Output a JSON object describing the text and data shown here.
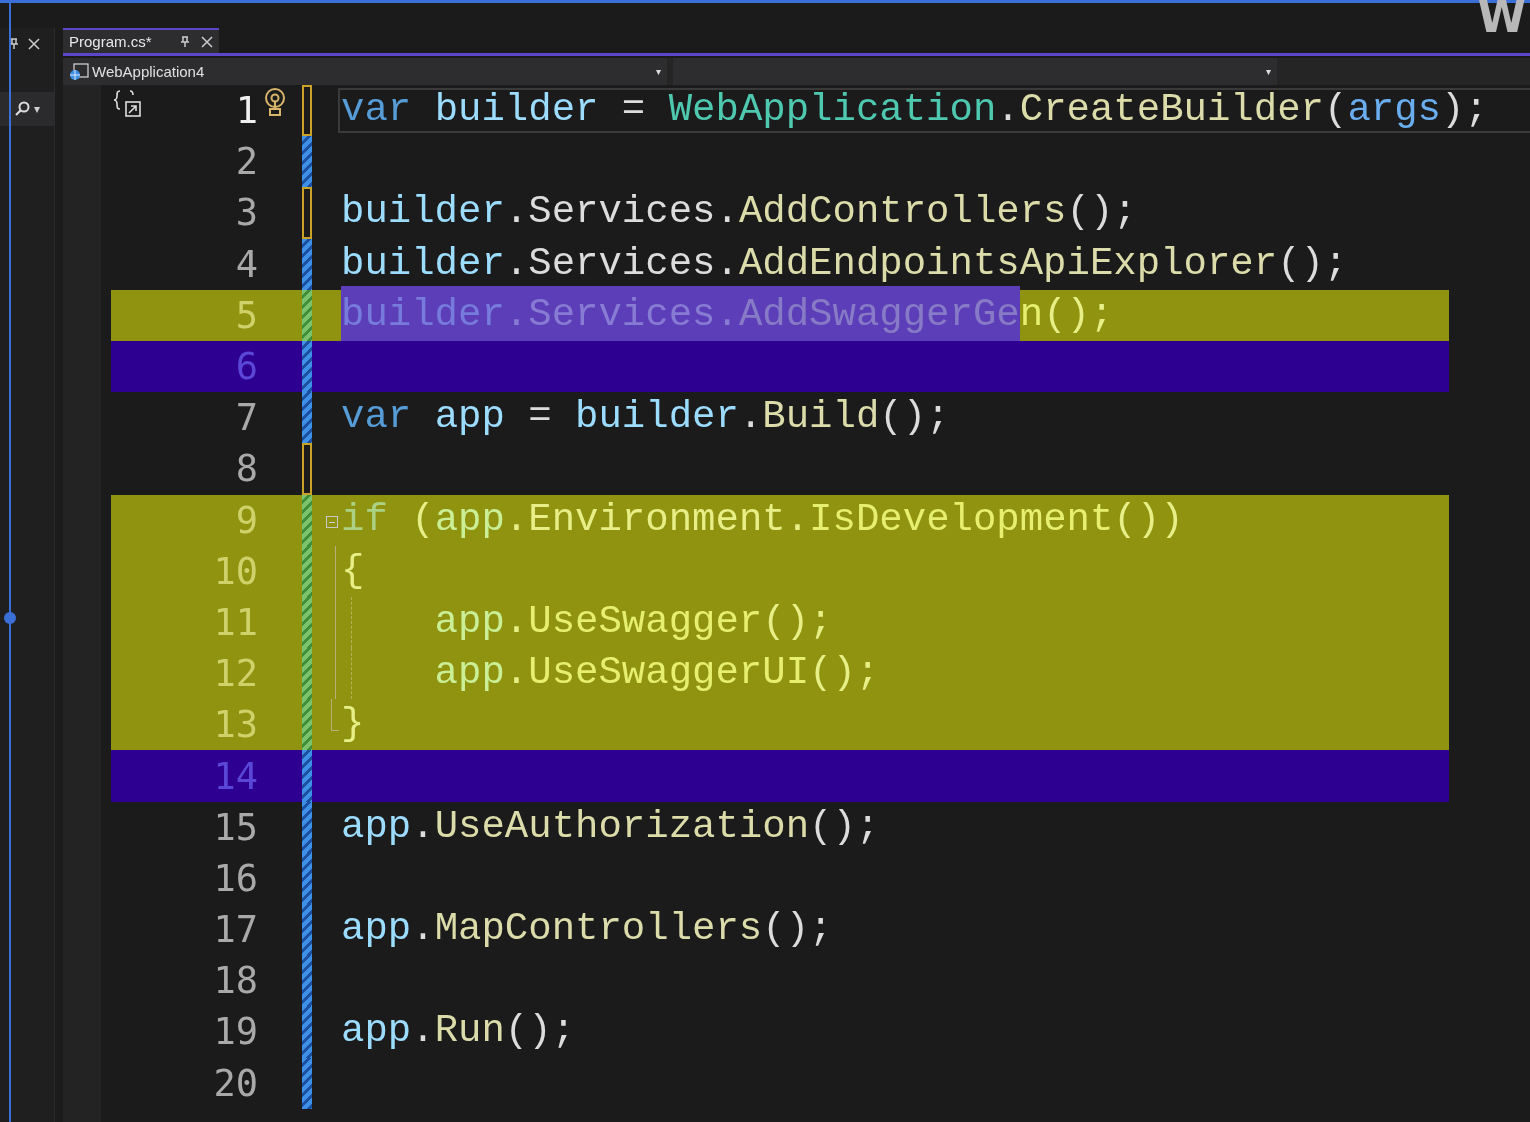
{
  "corner_text": "W",
  "tool_strip": {
    "search_caret": "▾"
  },
  "tabs": [
    {
      "label": "Program.cs*",
      "selected": true
    }
  ],
  "nav_bar": {
    "project": "WebApplication4",
    "caret": "▾",
    "member_caret": "▾"
  },
  "lines": [
    {
      "number": "1",
      "current": true,
      "lightbulb": true,
      "unsaved": true,
      "added": false,
      "removed": false,
      "tokens": [
        {
          "text": "var ",
          "kind": "keyword"
        },
        {
          "text": "builder",
          "kind": "local"
        },
        {
          "text": " = ",
          "kind": "plain"
        },
        {
          "text": "WebApplication",
          "kind": "type"
        },
        {
          "text": ".",
          "kind": "plain"
        },
        {
          "text": "CreateBuilder",
          "kind": "method"
        },
        {
          "text": "(",
          "kind": "plain"
        },
        {
          "text": "args",
          "kind": "param"
        },
        {
          "text": ");",
          "kind": "plain"
        }
      ]
    },
    {
      "number": "2",
      "current": false,
      "lightbulb": false,
      "unsaved": false,
      "added": false,
      "removed": false
    },
    {
      "number": "3",
      "current": false,
      "lightbulb": false,
      "unsaved": true,
      "added": false,
      "removed": false,
      "tokens": [
        {
          "text": "builder",
          "kind": "local"
        },
        {
          "text": ".",
          "kind": "plain"
        },
        {
          "text": "Services",
          "kind": "plain"
        },
        {
          "text": ".",
          "kind": "plain"
        },
        {
          "text": "AddControllers",
          "kind": "method"
        },
        {
          "text": "();",
          "kind": "plain"
        }
      ]
    },
    {
      "number": "4",
      "current": false,
      "lightbulb": false,
      "unsaved": false,
      "added": false,
      "removed": false,
      "tokens": [
        {
          "text": "builder",
          "kind": "local"
        },
        {
          "text": ".",
          "kind": "plain"
        },
        {
          "text": "Services",
          "kind": "plain"
        },
        {
          "text": ".",
          "kind": "plain"
        },
        {
          "text": "AddEndpointsApiExplorer",
          "kind": "method"
        },
        {
          "text": "();",
          "kind": "plain"
        }
      ]
    },
    {
      "number": "5",
      "current": false,
      "lightbulb": false,
      "unsaved": false,
      "added": true,
      "removed": false,
      "segments": [
        {
          "selected": true,
          "tokens": [
            {
              "text": "builder",
              "kind": "local"
            },
            {
              "text": ".",
              "kind": "plain"
            },
            {
              "text": "Services",
              "kind": "plain"
            },
            {
              "text": ".",
              "kind": "plain"
            },
            {
              "text": "AddSwaggerGe",
              "kind": "method"
            }
          ]
        },
        {
          "selected": false,
          "tokens": [
            {
              "text": "n",
              "kind": "method"
            },
            {
              "text": "();",
              "kind": "plain"
            }
          ]
        }
      ]
    },
    {
      "number": "6",
      "current": false,
      "lightbulb": false,
      "unsaved": false,
      "added": false,
      "removed": true
    },
    {
      "number": "7",
      "current": false,
      "lightbulb": false,
      "unsaved": false,
      "added": false,
      "removed": false,
      "tokens": [
        {
          "text": "var ",
          "kind": "keyword"
        },
        {
          "text": "app",
          "kind": "local"
        },
        {
          "text": " = ",
          "kind": "plain"
        },
        {
          "text": "builder",
          "kind": "local"
        },
        {
          "text": ".",
          "kind": "plain"
        },
        {
          "text": "Build",
          "kind": "method"
        },
        {
          "text": "();",
          "kind": "plain"
        }
      ]
    },
    {
      "number": "8",
      "current": false,
      "lightbulb": false,
      "unsaved": true,
      "added": false,
      "removed": false
    },
    {
      "number": "9",
      "current": false,
      "lightbulb": false,
      "unsaved": false,
      "added": true,
      "removed": false,
      "expanded": true,
      "tokens": [
        {
          "text": "if",
          "kind": "keyword"
        },
        {
          "text": " (",
          "kind": "plain"
        },
        {
          "text": "app",
          "kind": "local"
        },
        {
          "text": ".",
          "kind": "plain"
        },
        {
          "text": "Environment",
          "kind": "plain"
        },
        {
          "text": ".",
          "kind": "plain"
        },
        {
          "text": "IsDevelopment",
          "kind": "method"
        },
        {
          "text": "())",
          "kind": "plain"
        }
      ],
      "children": [
        {
          "number": "10",
          "current": false,
          "lightbulb": false,
          "unsaved": false,
          "added": true,
          "removed": false,
          "tokens": [
            {
              "text": "{",
              "kind": "plain"
            }
          ]
        },
        {
          "number": "11",
          "current": false,
          "lightbulb": false,
          "unsaved": false,
          "added": true,
          "removed": false,
          "tokens": [
            {
              "text": "    app",
              "kind": "local"
            },
            {
              "text": ".",
              "kind": "plain"
            },
            {
              "text": "UseSwagger",
              "kind": "method"
            },
            {
              "text": "();",
              "kind": "plain"
            }
          ]
        },
        {
          "number": "12",
          "current": false,
          "lightbulb": false,
          "unsaved": false,
          "added": true,
          "removed": false,
          "tokens": [
            {
              "text": "    app",
              "kind": "local"
            },
            {
              "text": ".",
              "kind": "plain"
            },
            {
              "text": "UseSwaggerUI",
              "kind": "method"
            },
            {
              "text": "();",
              "kind": "plain"
            }
          ]
        },
        {
          "number": "13",
          "current": false,
          "lightbulb": false,
          "unsaved": false,
          "added": true,
          "removed": false,
          "tokens": [
            {
              "text": "}",
              "kind": "plain"
            }
          ]
        }
      ]
    },
    {
      "number": "14",
      "current": false,
      "lightbulb": false,
      "unsaved": false,
      "added": false,
      "removed": true
    },
    {
      "number": "15",
      "current": false,
      "lightbulb": false,
      "unsaved": false,
      "added": false,
      "removed": false,
      "tokens": [
        {
          "text": "app",
          "kind": "local"
        },
        {
          "text": ".",
          "kind": "plain"
        },
        {
          "text": "UseAuthorization",
          "kind": "method"
        },
        {
          "text": "();",
          "kind": "plain"
        }
      ]
    },
    {
      "number": "16",
      "current": false,
      "lightbulb": false,
      "unsaved": false,
      "added": false,
      "removed": false
    },
    {
      "number": "17",
      "current": false,
      "lightbulb": false,
      "unsaved": false,
      "added": false,
      "removed": false,
      "tokens": [
        {
          "text": "app",
          "kind": "local"
        },
        {
          "text": ".",
          "kind": "plain"
        },
        {
          "text": "MapControllers",
          "kind": "method"
        },
        {
          "text": "();",
          "kind": "plain"
        }
      ]
    },
    {
      "number": "18",
      "current": false,
      "lightbulb": false,
      "unsaved": false,
      "added": false,
      "removed": false
    },
    {
      "number": "19",
      "current": false,
      "lightbulb": false,
      "unsaved": false,
      "added": false,
      "removed": false,
      "tokens": [
        {
          "text": "app",
          "kind": "local"
        },
        {
          "text": ".",
          "kind": "plain"
        },
        {
          "text": "Run",
          "kind": "method"
        },
        {
          "text": "();",
          "kind": "plain"
        }
      ]
    },
    {
      "number": "20",
      "current": false,
      "lightbulb": false,
      "unsaved": false,
      "added": false,
      "removed": false
    }
  ]
}
